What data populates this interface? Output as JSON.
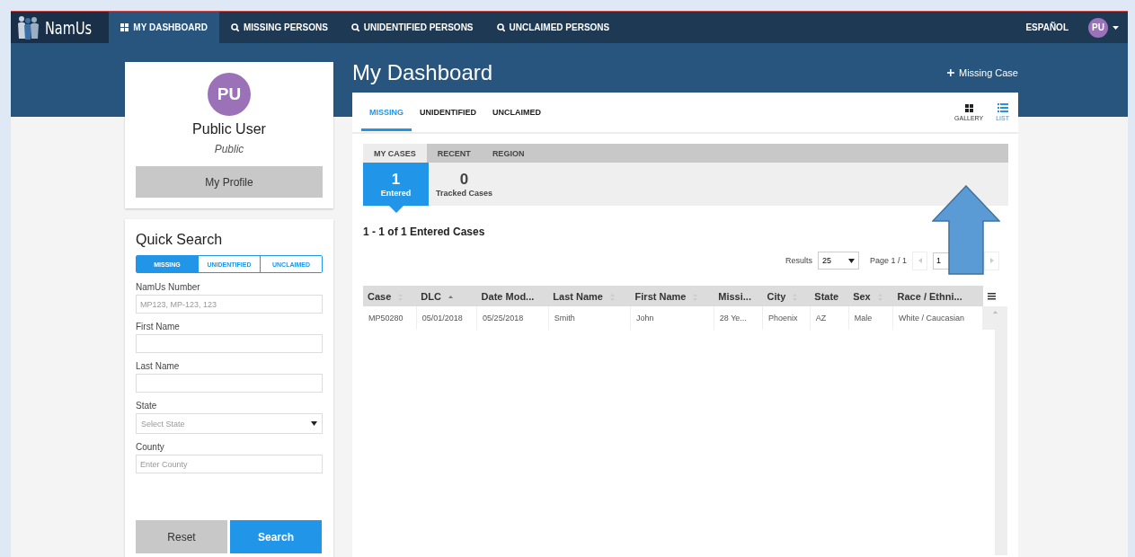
{
  "nav": {
    "logo": "NamUs",
    "items": [
      {
        "label": "MY DASHBOARD",
        "selected": true
      },
      {
        "label": "MISSING PERSONS",
        "selected": false
      },
      {
        "label": "UNIDENTIFIED PERSONS",
        "selected": false
      },
      {
        "label": "UNCLAIMED PERSONS",
        "selected": false
      }
    ],
    "language": "ESPAÑOL",
    "avatar": "PU"
  },
  "profile": {
    "initials": "PU",
    "name": "Public User",
    "role": "Public",
    "button": "My Profile"
  },
  "quick_search": {
    "title": "Quick Search",
    "tabs": [
      {
        "label": "MISSING",
        "selected": true
      },
      {
        "label": "UNIDENTIFIED",
        "selected": false
      },
      {
        "label": "UNCLAIMED",
        "selected": false
      }
    ],
    "fields": [
      {
        "label": "NamUs Number",
        "kind": "text",
        "placeholder": "MP123, MP-123, 123"
      },
      {
        "label": "First Name",
        "kind": "text"
      },
      {
        "label": "Last Name",
        "kind": "text"
      },
      {
        "label": "State",
        "kind": "select",
        "placeholder": "Select State"
      },
      {
        "label": "County",
        "kind": "text",
        "placeholder": "Enter County"
      }
    ],
    "buttons": [
      {
        "label": "Reset",
        "kind": "secondary"
      },
      {
        "label": "Search",
        "kind": "primary"
      }
    ]
  },
  "page_title": "My Dashboard",
  "add_button": "Missing Case",
  "category_tabs": [
    {
      "label": "MISSING",
      "selected": true
    },
    {
      "label": "UNIDENTIFIED",
      "selected": false
    },
    {
      "label": "UNCLAIMED",
      "selected": false
    }
  ],
  "view_toggle": [
    {
      "label": "GALLERY",
      "selected": false
    },
    {
      "label": "LIST",
      "selected": true
    }
  ],
  "sub_tabs": [
    {
      "label": "MY CASES",
      "selected": true
    },
    {
      "label": "RECENT",
      "selected": false
    },
    {
      "label": "REGION",
      "selected": false
    }
  ],
  "counters": [
    {
      "value": "1",
      "label": "Entered",
      "selected": true
    },
    {
      "value": "0",
      "label": "Tracked Cases",
      "selected": false
    }
  ],
  "summary": "1 - 1 of 1 Entered Cases",
  "pagination": {
    "results_label": "Results",
    "results_value": "25",
    "page_label": "Page 1 / 1",
    "page_value": "1"
  },
  "table": {
    "columns": [
      {
        "label": "Case",
        "sortable": true,
        "sorted": false
      },
      {
        "label": "DLC",
        "sortable": true,
        "sorted": true
      },
      {
        "label": "Date Mod...",
        "sortable": false,
        "sorted": false
      },
      {
        "label": "Last Name",
        "sortable": true,
        "sorted": false
      },
      {
        "label": "First Name",
        "sortable": true,
        "sorted": false
      },
      {
        "label": "Missi...",
        "sortable": false,
        "sorted": false
      },
      {
        "label": "City",
        "sortable": true,
        "sorted": false
      },
      {
        "label": "State",
        "sortable": false,
        "sorted": false
      },
      {
        "label": "Sex",
        "sortable": true,
        "sorted": false
      },
      {
        "label": "Race / Ethni...",
        "sortable": false,
        "sorted": false
      }
    ],
    "rows": [
      [
        "MP50280",
        "05/01/2018",
        "05/25/2018",
        "Smith",
        "John",
        "28 Ye...",
        "Phoenix",
        "AZ",
        "Male",
        "White / Caucasian"
      ]
    ]
  }
}
